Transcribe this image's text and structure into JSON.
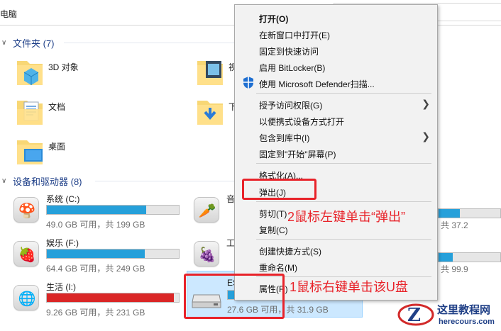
{
  "addressbar": {
    "text": "电脑"
  },
  "groups": {
    "folders": "文件夹 (7)",
    "drives": "设备和驱动器 (8)"
  },
  "folders": [
    {
      "name": "3D 对象",
      "icon": "3d-objects-folder-icon"
    },
    {
      "name": "视",
      "icon": "videos-folder-icon"
    },
    {
      "name": "文档",
      "icon": "documents-folder-icon"
    },
    {
      "name": "下",
      "icon": "downloads-folder-icon"
    },
    {
      "name": "桌面",
      "icon": "desktop-folder-icon"
    }
  ],
  "drives": [
    {
      "name": "系统 (C:)",
      "free": "49.0 GB 可用，共 199 GB",
      "used_fraction": 0.75,
      "bar_color": "#26a0da",
      "icon": "mushroom-icon"
    },
    {
      "name": "音",
      "free": "",
      "used_fraction": 0.0,
      "bar_color": "#26a0da",
      "icon": "carrot-icon"
    },
    {
      "name": "娱乐 (F:)",
      "free": "64.4 GB 可用，共 249 GB",
      "used_fraction": 0.74,
      "bar_color": "#26a0da",
      "icon": "strawberry-icon"
    },
    {
      "name": "工",
      "free": "",
      "used_fraction": 0.0,
      "bar_color": "#26a0da",
      "icon": "grapes-icon"
    },
    {
      "name": "生活 (I:)",
      "free": "9.26 GB 可用，共 231 GB",
      "used_fraction": 0.96,
      "bar_color": "#da2626",
      "icon": "globe-icon"
    },
    {
      "name": "ES",
      "free": "27.6 GB 可用，共 31.9 GB",
      "used_fraction": 0.13,
      "bar_color": "#26a0da",
      "icon": "usb-drive-icon"
    }
  ],
  "right_col_frag": {
    "r1": "共 37.2",
    "r2": "共 99.9"
  },
  "context_menu": [
    {
      "label": "打开(O)",
      "bold": true
    },
    {
      "label": "在新窗口中打开(E)"
    },
    {
      "label": "固定到快速访问"
    },
    {
      "label": "启用 BitLocker(B)"
    },
    {
      "label": "使用 Microsoft Defender扫描...",
      "icon": "defender-shield-icon"
    },
    {
      "label": "授予访问权限(G)",
      "submenu": true
    },
    {
      "label": "以便携式设备方式打开"
    },
    {
      "label": "包含到库中(I)",
      "submenu": true
    },
    {
      "label": "固定到\"开始\"屏幕(P)"
    },
    {
      "label": "格式化(A)..."
    },
    {
      "label": "弹出(J)"
    },
    {
      "label": "剪切(T)"
    },
    {
      "label": "复制(C)"
    },
    {
      "label": "创建快捷方式(S)"
    },
    {
      "label": "重命名(M)"
    },
    {
      "label": "属性(R)"
    }
  ],
  "annotations": {
    "step2": "2鼠标左键单击“弹出”",
    "step1": "1鼠标右键单击该U盘"
  },
  "watermark": {
    "title": "这里教程网",
    "url": "herecours.com"
  },
  "colors": {
    "accent": "#26a0da",
    "danger": "#da2626",
    "annotation": "#e8232a",
    "selection": "#cce8ff"
  }
}
